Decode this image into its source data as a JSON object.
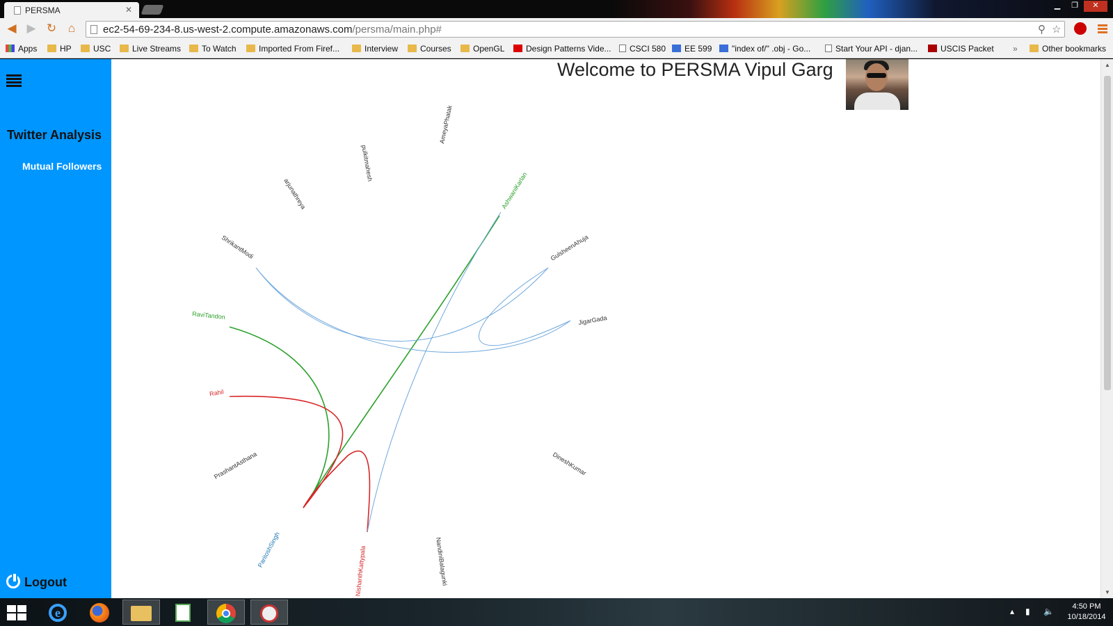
{
  "browser": {
    "tab_title": "PERSMA",
    "url_host": "ec2-54-69-234-8.us-west-2.compute.amazonaws.com",
    "url_path": "/persma/main.php#"
  },
  "bookmarks": [
    {
      "label": "Apps",
      "icon": "apps-icon"
    },
    {
      "label": "HP",
      "icon": "folder-icon"
    },
    {
      "label": "USC",
      "icon": "folder-icon"
    },
    {
      "label": "Live Streams",
      "icon": "folder-icon"
    },
    {
      "label": "To Watch",
      "icon": "folder-icon"
    },
    {
      "label": "Imported From Firef...",
      "icon": "folder-icon"
    },
    {
      "label": "Interview",
      "icon": "folder-icon"
    },
    {
      "label": "Courses",
      "icon": "folder-icon"
    },
    {
      "label": "OpenGL",
      "icon": "folder-icon"
    },
    {
      "label": "Design Patterns Vide...",
      "icon": "youtube-icon"
    },
    {
      "label": "CSCI 580",
      "icon": "document-icon"
    },
    {
      "label": "EE 599",
      "icon": "piazza-icon"
    },
    {
      "label": "\"index of/\" .obj - Go...",
      "icon": "google-icon"
    },
    {
      "label": "Start Your API - djan...",
      "icon": "document-icon"
    },
    {
      "label": "USCIS Packet",
      "icon": "usc-icon"
    }
  ],
  "bookmarks_overflow": "»",
  "other_bookmarks": "Other bookmarks",
  "sidebar": {
    "section_title": "Twitter Analysis",
    "link": "Mutual Followers",
    "logout": "Logout"
  },
  "header": {
    "welcome": "Welcome to PERSMA Vipul Garg"
  },
  "graph": {
    "nodes": [
      {
        "name": "pulkitmahesh",
        "color": "#333333"
      },
      {
        "name": "AmeyaPhatak",
        "color": "#333333"
      },
      {
        "name": "AshwaniKarlan",
        "color": "#2ca02c"
      },
      {
        "name": "arjunathreya",
        "color": "#333333"
      },
      {
        "name": "ShrikantModi",
        "color": "#333333"
      },
      {
        "name": "GulsheenAhuja",
        "color": "#333333"
      },
      {
        "name": "JigarGada",
        "color": "#333333"
      },
      {
        "name": "RaviTandon",
        "color": "#2ca02c"
      },
      {
        "name": "Rahil",
        "color": "#d62728"
      },
      {
        "name": "PrashantAsthana",
        "color": "#333333"
      },
      {
        "name": "DineshKumar",
        "color": "#333333"
      },
      {
        "name": "ParitoshSingh",
        "color": "#1f77b4"
      },
      {
        "name": "NishanthKattypala",
        "color": "#d62728"
      },
      {
        "name": "NandiniBalagunki",
        "color": "#333333"
      }
    ],
    "colors": {
      "green": "#2ca02c",
      "red": "#d62728",
      "blue": "#6fa8dc"
    }
  },
  "taskbar": {
    "time": "4:50 PM",
    "date": "10/18/2014",
    "apps": [
      "internet-explorer-icon",
      "firefox-icon",
      "file-explorer-icon",
      "notepad-plus-icon",
      "chrome-icon",
      "snipping-tool-icon"
    ]
  }
}
